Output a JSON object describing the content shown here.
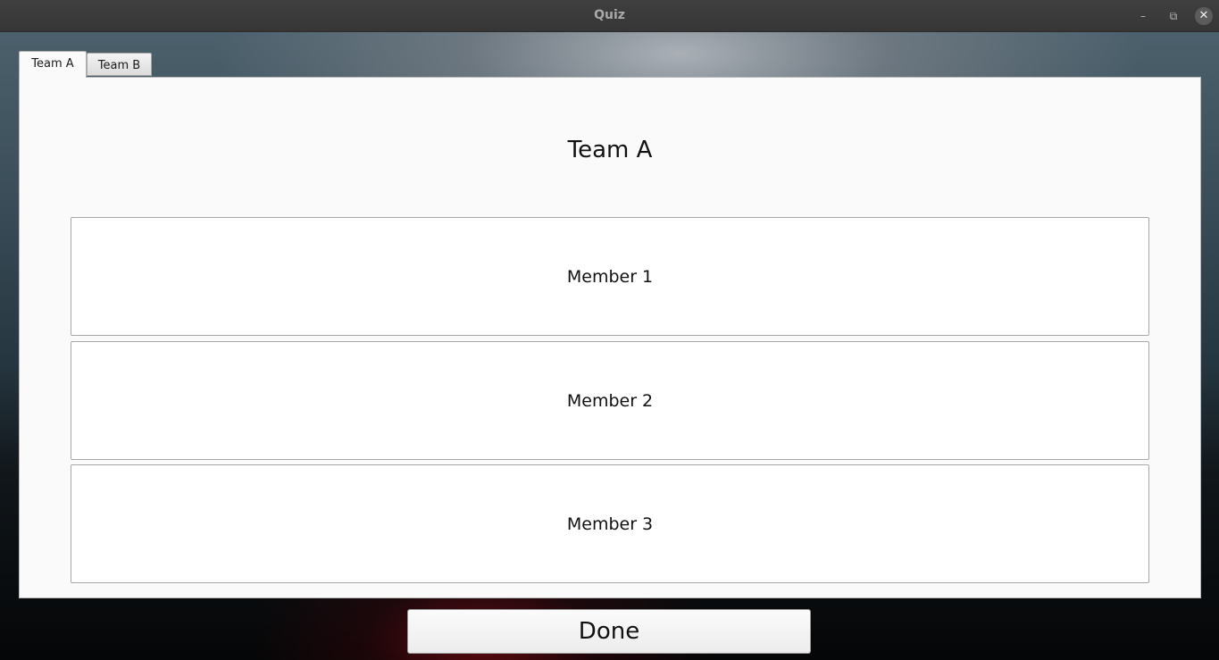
{
  "window": {
    "title": "Quiz",
    "controls": {
      "minimize": "–",
      "maximize": "⧉",
      "close": "✕"
    }
  },
  "tabs": [
    {
      "label": "Team A",
      "active": true
    },
    {
      "label": "Team B",
      "active": false
    }
  ],
  "main": {
    "heading": "Team A",
    "members": [
      "Member 1",
      "Member 2",
      "Member 3"
    ]
  },
  "footer": {
    "done_label": "Done"
  }
}
